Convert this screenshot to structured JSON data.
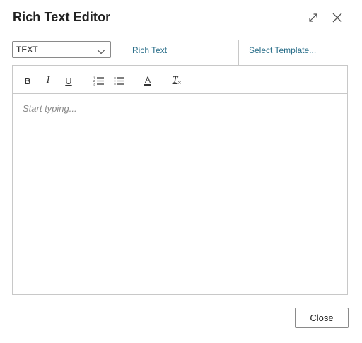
{
  "dialog": {
    "title": "Rich Text Editor",
    "expand_icon": "expand-icon",
    "close_icon": "close-icon"
  },
  "format_select": {
    "value": "TEXT"
  },
  "links": {
    "rich_text": "Rich Text",
    "select_template": "Select Template..."
  },
  "toolbar": {
    "items": [
      {
        "name": "bold",
        "label": "B"
      },
      {
        "name": "italic",
        "label": "I"
      },
      {
        "name": "underline",
        "label": "U"
      },
      {
        "name": "ordered-list",
        "icon": "ordered-list-icon"
      },
      {
        "name": "bullet-list",
        "icon": "bullet-list-icon"
      },
      {
        "name": "font-color",
        "label": "A"
      },
      {
        "name": "clear-format",
        "label": "T"
      }
    ]
  },
  "editor": {
    "placeholder": "Start typing..."
  },
  "footer": {
    "close_label": "Close"
  },
  "colors": {
    "link": "#2b6f8a",
    "border": "#c8c8c8",
    "placeholder": "#8a8a8a"
  }
}
